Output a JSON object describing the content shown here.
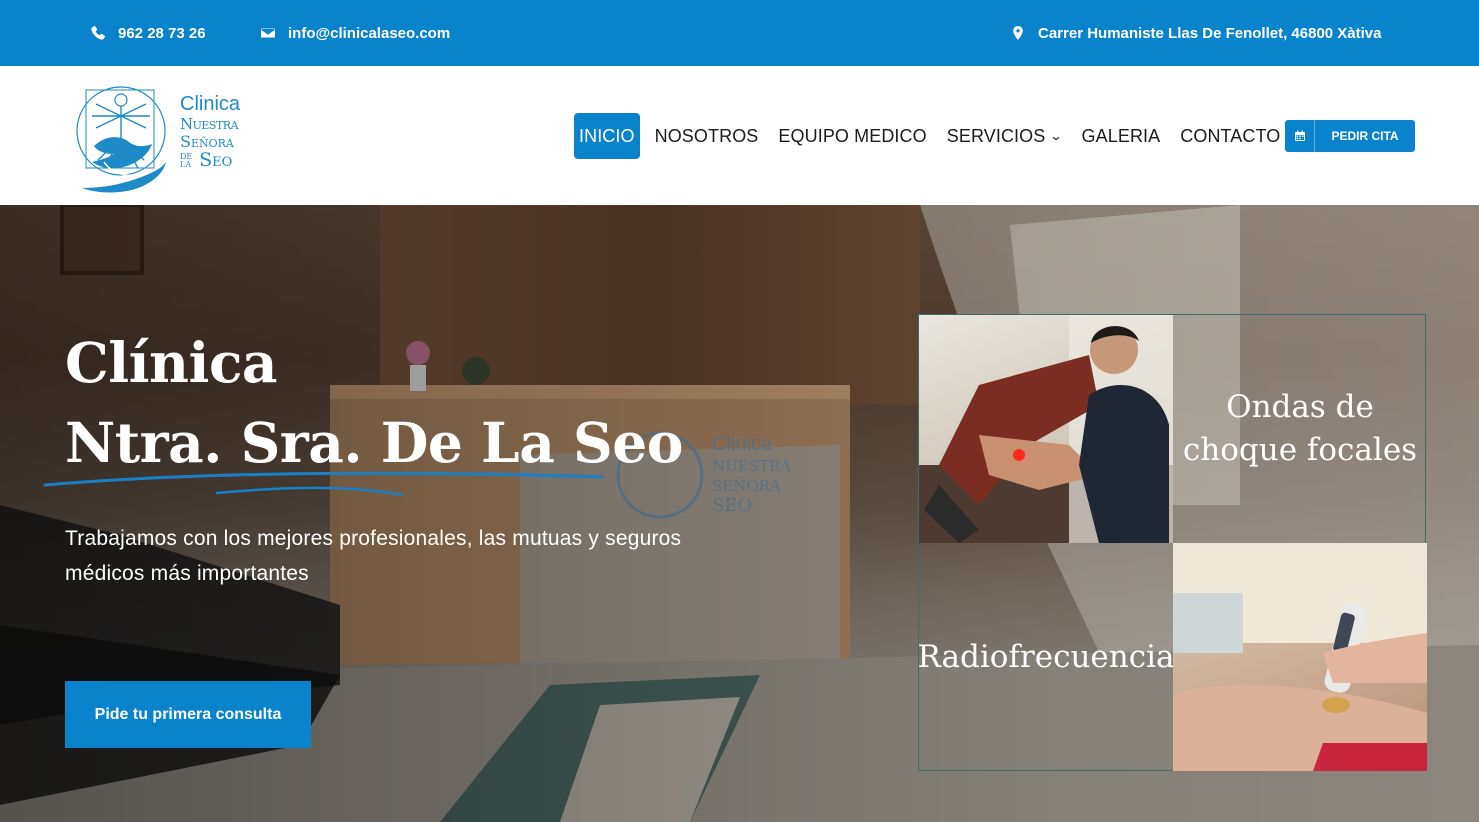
{
  "topbar": {
    "phone": "962 28 73 26",
    "email": "info@clinicalaseo.com",
    "address": "Carrer Humaniste Llas De Fenollet, 46800 Xàtiva"
  },
  "logo": {
    "line1": "Clinica",
    "line2": "Nuestra",
    "line3": "Señora",
    "line4a": "DE LA",
    "line4b": "Seo"
  },
  "nav": {
    "items": [
      "INICIO",
      "NOSOTROS",
      "EQUIPO MEDICO",
      "SERVICIOS",
      "GALERIA",
      "CONTACTO"
    ],
    "cta": "PEDIR CITA"
  },
  "hero": {
    "title_line1": "Clínica",
    "title_line2": "Ntra. Sra. De La Seo",
    "subtitle": "Trabajamos con los mejores profesionales, las mutuas y seguros médicos más importantes",
    "button": "Pide tu primera consulta"
  },
  "services": {
    "card1": "Ondas de choque focales",
    "card2": "Radiofrecuencia"
  },
  "colors": {
    "brand": "#0a83cd",
    "logo": "#1d8bc7"
  }
}
